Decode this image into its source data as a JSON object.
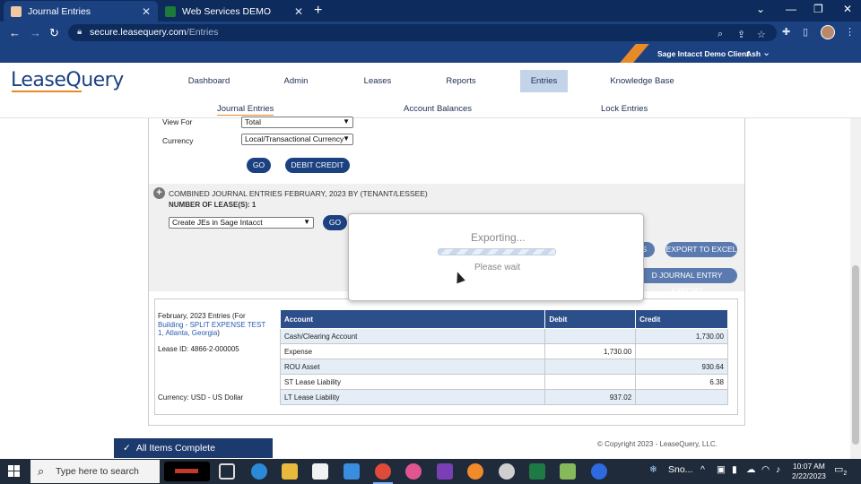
{
  "browser": {
    "tabs": [
      {
        "title": "Journal Entries",
        "active": true,
        "close": "✕"
      },
      {
        "title": "Web Services DEMO",
        "active": false,
        "close": "✕"
      }
    ],
    "new_tab": "+",
    "url_host": "secure.leasequery.com",
    "url_path": "/Entries",
    "window_controls": {
      "minimize": "⌄",
      "restore": "—",
      "maximize": "❐",
      "close": "✕"
    }
  },
  "header": {
    "logo_text": "LeaseQuery",
    "client_name": "Sage Intacct Demo Client",
    "user_name": "Ash",
    "user_caret": "⌄",
    "nav": [
      {
        "label": "Dashboard"
      },
      {
        "label": "Admin"
      },
      {
        "label": "Leases"
      },
      {
        "label": "Reports"
      },
      {
        "label": "Entries",
        "active": true
      },
      {
        "label": "Knowledge Base"
      }
    ],
    "subnav": [
      {
        "label": "Journal Entries",
        "active": true
      },
      {
        "label": "Account Balances"
      },
      {
        "label": "Lock Entries"
      }
    ]
  },
  "filters": {
    "view_for_label": "View For",
    "view_for_value": "Total",
    "currency_label": "Currency",
    "currency_value": "Local/Transactional Currency",
    "go_label": "GO",
    "debit_credit_label": "DEBIT CREDIT"
  },
  "section": {
    "title": "COMBINED JOURNAL ENTRIES FEBRUARY, 2023 BY (TENANT/LESSEE)",
    "lease_count": "NUMBER OF LEASE(S): 1",
    "action_select": "Create JEs in Sage Intacct",
    "go_label": "GO",
    "ls_button": "LS",
    "export_excel": "EXPORT TO EXCEL",
    "je_export": "D JOURNAL ENTRY EXPORT"
  },
  "entry": {
    "period_prefix": "February, 2023 Entries (For ",
    "period_link": "Building - SPLIT EXPENSE TEST 1, Atlanta, Georgia",
    "period_suffix": ")",
    "lease_id": "Lease ID: 4866-2-000005",
    "currency": "Currency: USD - US Dollar",
    "columns": [
      "Account",
      "Debit",
      "Credit"
    ],
    "rows": [
      {
        "account": "Cash/Clearing Account",
        "debit": "",
        "credit": "1,730.00"
      },
      {
        "account": "Expense",
        "debit": "1,730.00",
        "credit": ""
      },
      {
        "account": "ROU Asset",
        "debit": "",
        "credit": "930.64"
      },
      {
        "account": "ST Lease Liability",
        "debit": "",
        "credit": "6.38"
      },
      {
        "account": "LT Lease Liability",
        "debit": "937.02",
        "credit": ""
      }
    ]
  },
  "modal": {
    "title": "Exporting...",
    "subtitle": "Please wait"
  },
  "footer": {
    "copyright": "© Copyright 2023 - LeaseQuery, LLC.",
    "complete_check": "✓",
    "complete_label": "All Items Complete"
  },
  "taskbar": {
    "search_placeholder": "Type here to search",
    "weather_text": "Sno...",
    "time": "10:07 AM",
    "date": "2/22/2023",
    "notification_count": "2"
  },
  "colors": {
    "brand_navy": "#1c4181",
    "accent_orange": "#e88a28",
    "table_header": "#2c4f8a"
  }
}
